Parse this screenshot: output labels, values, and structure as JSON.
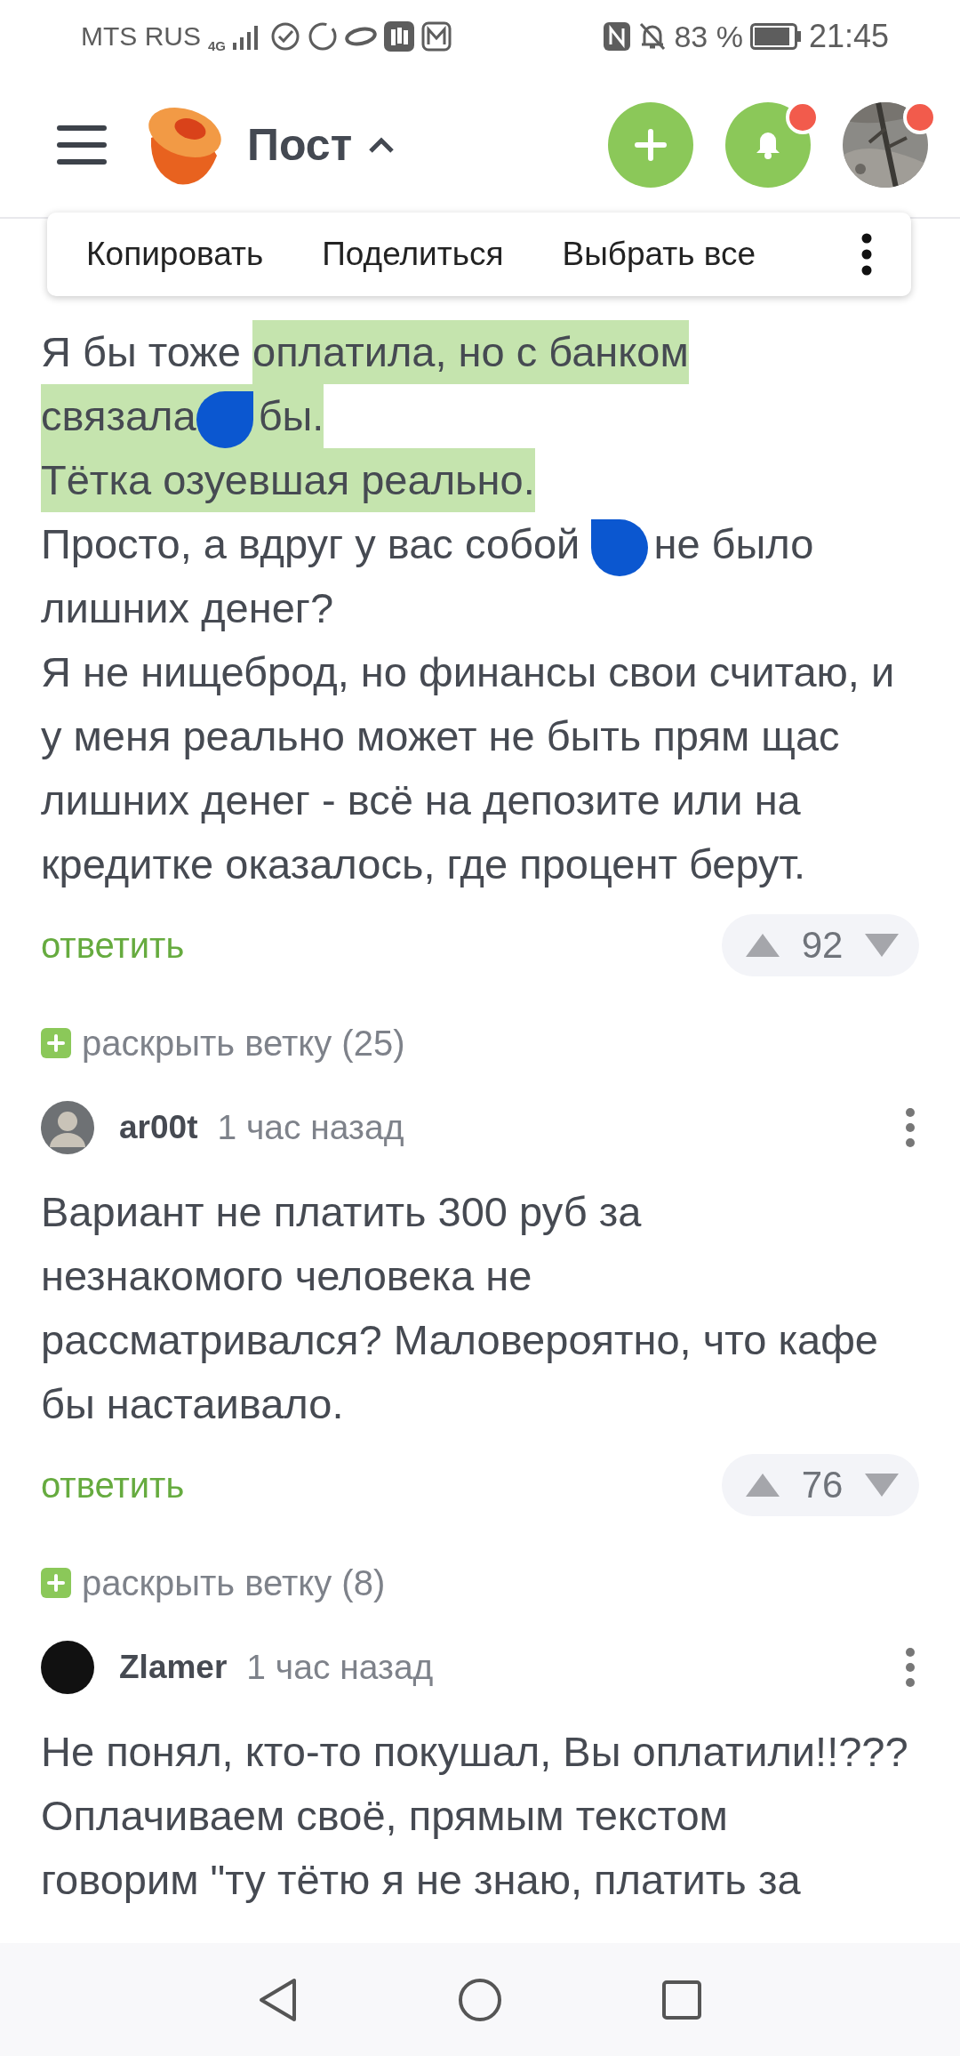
{
  "status_bar": {
    "carrier": "MTS RUS",
    "network": "4G",
    "battery": "83 %",
    "time": "21:45"
  },
  "header": {
    "title": "Пост",
    "notifications": {
      "badge": true
    },
    "profile": {
      "badge": true
    }
  },
  "context_menu": {
    "items": [
      "Копировать",
      "Поделиться",
      "Выбрать все"
    ]
  },
  "comments": [
    {
      "lines": [
        [
          {
            "text": "Я бы тоже ",
            "selected": false
          },
          {
            "text": "оплатила, но с банком ",
            "selected": true
          }
        ],
        [
          {
            "text": "связала ",
            "selected": true,
            "handle_after": true
          },
          {
            "text": "бы. ",
            "selected": true
          }
        ],
        [
          {
            "text": "Тётка озуевшая реально.",
            "selected": true
          }
        ],
        [
          {
            "text": "Просто, а вдруг у вас собой ",
            "selected": false,
            "handle_after": true
          },
          {
            "text": "не было",
            "selected": false
          }
        ],
        [
          {
            "text": "лишних денег?",
            "selected": false
          }
        ],
        [
          {
            "text": "Я не нищеброд, но финансы свои считаю, и",
            "selected": false
          }
        ],
        [
          {
            "text": "у меня реально может не быть прям щас",
            "selected": false
          }
        ],
        [
          {
            "text": "лишних денег - всё на депозите или на",
            "selected": false
          }
        ],
        [
          {
            "text": "кредитке оказалось, где процент берут.",
            "selected": false
          }
        ]
      ],
      "reply": "ответить",
      "rating": "92",
      "thread": "раскрыть ветку (25)"
    },
    {
      "author": "ar00t",
      "time": "1 час назад",
      "lines": [
        [
          {
            "text": "Вариант не платить 300 руб за",
            "selected": false
          }
        ],
        [
          {
            "text": "незнакомого человека не",
            "selected": false
          }
        ],
        [
          {
            "text": "рассматривался? Маловероятно, что кафе",
            "selected": false
          }
        ],
        [
          {
            "text": "бы настаивало.",
            "selected": false
          }
        ]
      ],
      "reply": "ответить",
      "rating": "76",
      "thread": "раскрыть ветку (8)"
    },
    {
      "author": "Zlamer",
      "time": "1 час назад",
      "lines": [
        [
          {
            "text": "Не понял, кто-то покушал, Вы оплатили!!???",
            "selected": false
          }
        ],
        [
          {
            "text": "Оплачиваем своё, прямым текстом",
            "selected": false
          }
        ],
        [
          {
            "text": "говорим \"ту тётю я не знаю, платить за",
            "selected": false
          }
        ]
      ]
    }
  ]
}
